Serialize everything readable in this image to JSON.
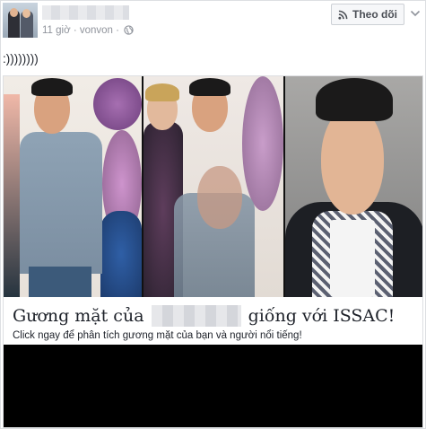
{
  "post": {
    "author_name": "",
    "timestamp": "11 giờ",
    "location": "vonvon",
    "separator": "·",
    "text": ":))))))))",
    "follow_label": "Theo dõi"
  },
  "link_card": {
    "headline_before": "Gương mặt của",
    "headline_after": "giống với ISSAC!",
    "subtitle": "Click ngay để phân tích gương mặt của bạn và người nổi tiếng!"
  },
  "icons": {
    "follow": "rss-icon",
    "menu": "chevron-down-icon",
    "audience": "globe-icon"
  },
  "colors": {
    "meta_text": "#90949c",
    "button_bg": "#f6f7f9",
    "border": "#dddfe2",
    "black_area": "#000000"
  }
}
